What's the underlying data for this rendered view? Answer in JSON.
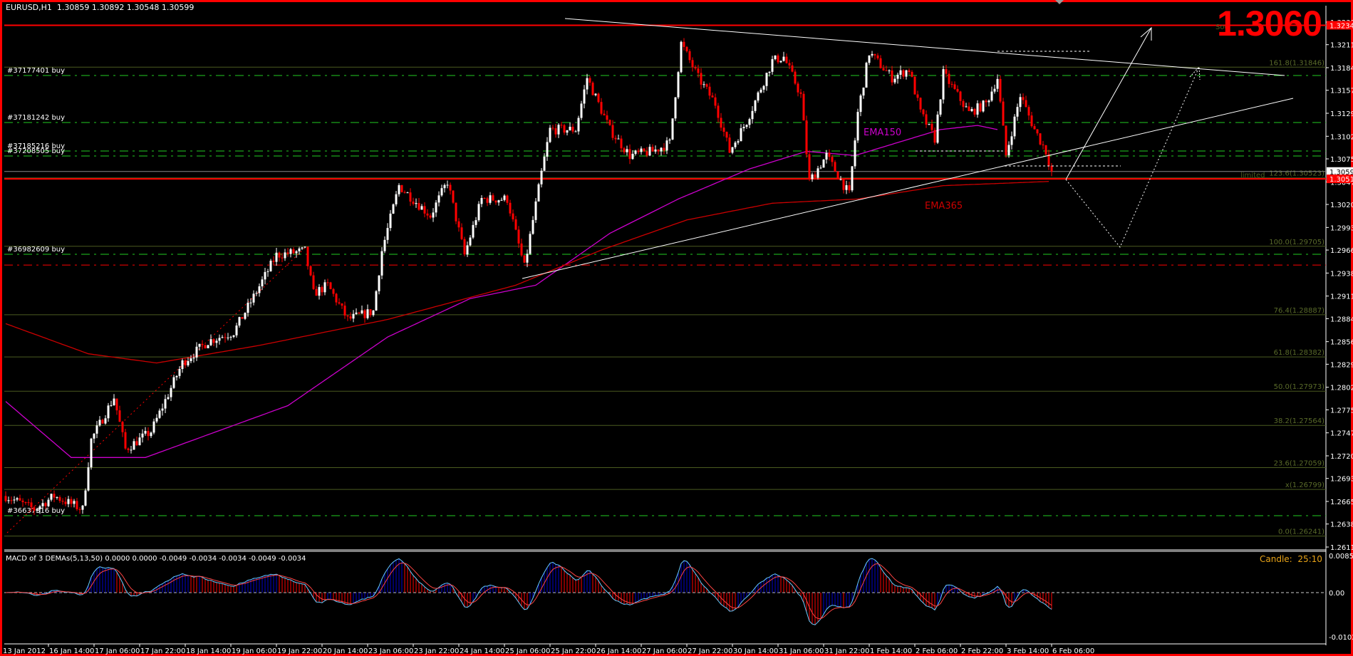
{
  "header": {
    "symbol": "EURUSD,H1",
    "open": "1.30859",
    "high": "1.30892",
    "low": "1.30548",
    "close": "1.30599"
  },
  "big_price": "1.3060",
  "candle_timer": {
    "label": "Candle:",
    "value": "25:10"
  },
  "macd": {
    "title": "MACD of 3 DEMAs(5,13,50) 0.0000 0.0000 -0.0049 -0.0034 -0.0034 -0.0049 -0.0034",
    "scale": [
      "0.0085",
      "0.00",
      "-0.0102"
    ]
  },
  "labels": {
    "ema150": "EMA150",
    "ema365": "EMA365",
    "limited": "limited",
    "source": "Sou"
  },
  "colors": {
    "bull": "#ffffff",
    "bear": "#ff0000",
    "ema150": "#cc00cc",
    "ema365": "#cc0000",
    "fib": "#4b5b20",
    "order": "#22cc22",
    "stop": "#ff0000",
    "macd_pos": "#0000cc",
    "macd_neg": "#ff0000",
    "macd_line": "#66ccff",
    "signal": "#ff4444",
    "timer": "#e8a317"
  },
  "orders": [
    {
      "label": "#37177401 buy",
      "price": 1.31746
    },
    {
      "label": "#37181242 buy",
      "price": 1.31185
    },
    {
      "label": "#37185216 buy",
      "price": 1.30844
    },
    {
      "label": "#37208505 buy",
      "price": 1.30784
    },
    {
      "label": "#36982609 buy",
      "price": 1.29609
    },
    {
      "label": "#36637316 buy",
      "price": 1.26485
    }
  ],
  "stop_level": 1.29481,
  "fib_levels": [
    {
      "label": "161.8(1.31846)",
      "price": 1.31846
    },
    {
      "label": "123.6(1.30523)",
      "price": 1.30523
    },
    {
      "label": "100.0(1.29705)",
      "price": 1.29705
    },
    {
      "label": "76.4(1.28887)",
      "price": 1.28887
    },
    {
      "label": "61.8(1.28382)",
      "price": 1.28382
    },
    {
      "label": "50.0(1.27973)",
      "price": 1.27973
    },
    {
      "label": "38.2(1.27564)",
      "price": 1.27564
    },
    {
      "label": "23.6(1.27059)",
      "price": 1.27059
    },
    {
      "label": "x(1.26799)",
      "price": 1.26799
    },
    {
      "label": "0.0(1.26241)",
      "price": 1.26241
    }
  ],
  "price_tags": [
    {
      "label": "1.32347",
      "price": 1.32347,
      "style": "red"
    },
    {
      "label": "1.30599",
      "price": 1.30599,
      "style": "white"
    },
    {
      "label": "1.30511",
      "price": 1.30511,
      "style": "red"
    }
  ],
  "chart_data": {
    "type": "candlestick",
    "title": "EURUSD,H1",
    "y_axis_ticks": [
      "1.32385",
      "1.32115",
      "1.31840",
      "1.31570",
      "1.31295",
      "1.31020",
      "1.30750",
      "1.30475",
      "1.30205",
      "1.29930",
      "1.29660",
      "1.29385",
      "1.29110",
      "1.28840",
      "1.28565",
      "1.28295",
      "1.28020",
      "1.27750",
      "1.27475",
      "1.27200",
      "1.26930",
      "1.26655",
      "1.26385",
      "1.26110"
    ],
    "ylim": [
      1.2611,
      1.32385
    ],
    "x_axis_ticks": [
      "13 Jan 2012",
      "16 Jan 14:00",
      "17 Jan 06:00",
      "17 Jan 22:00",
      "18 Jan 14:00",
      "19 Jan 06:00",
      "19 Jan 22:00",
      "20 Jan 14:00",
      "23 Jan 06:00",
      "23 Jan 22:00",
      "24 Jan 14:00",
      "25 Jan 06:00",
      "25 Jan 22:00",
      "26 Jan 14:00",
      "27 Jan 06:00",
      "27 Jan 22:00",
      "30 Jan 14:00",
      "31 Jan 06:00",
      "31 Jan 22:00",
      "1 Feb 14:00",
      "2 Feb 06:00",
      "2 Feb 22:00",
      "3 Feb 14:00",
      "6 Feb 06:00"
    ],
    "bars": 368,
    "close_anchors": [
      [
        0,
        1.2672
      ],
      [
        10,
        1.2656
      ],
      [
        17,
        1.2672
      ],
      [
        27,
        1.2656
      ],
      [
        30,
        1.2739
      ],
      [
        38,
        1.279
      ],
      [
        42,
        1.2728
      ],
      [
        51,
        1.2749
      ],
      [
        62,
        1.2831
      ],
      [
        71,
        1.2857
      ],
      [
        80,
        1.2868
      ],
      [
        86,
        1.2904
      ],
      [
        95,
        1.296
      ],
      [
        105,
        1.2965
      ],
      [
        108,
        1.2914
      ],
      [
        113,
        1.2924
      ],
      [
        120,
        1.2883
      ],
      [
        129,
        1.2893
      ],
      [
        132,
        1.2965
      ],
      [
        138,
        1.3043
      ],
      [
        149,
        1.3007
      ],
      [
        155,
        1.3048
      ],
      [
        161,
        1.296
      ],
      [
        167,
        1.3027
      ],
      [
        176,
        1.3027
      ],
      [
        182,
        1.2945
      ],
      [
        188,
        1.3058
      ],
      [
        191,
        1.311
      ],
      [
        200,
        1.311
      ],
      [
        204,
        1.3172
      ],
      [
        212,
        1.311
      ],
      [
        219,
        1.3079
      ],
      [
        227,
        1.3084
      ],
      [
        233,
        1.3094
      ],
      [
        237,
        1.3213
      ],
      [
        243,
        1.3172
      ],
      [
        249,
        1.3141
      ],
      [
        254,
        1.3084
      ],
      [
        260,
        1.312
      ],
      [
        269,
        1.3192
      ],
      [
        273,
        1.3197
      ],
      [
        279,
        1.3151
      ],
      [
        282,
        1.3048
      ],
      [
        288,
        1.3079
      ],
      [
        296,
        1.3032
      ],
      [
        299,
        1.313
      ],
      [
        303,
        1.3202
      ],
      [
        311,
        1.3172
      ],
      [
        317,
        1.3182
      ],
      [
        321,
        1.313
      ],
      [
        326,
        1.3099
      ],
      [
        329,
        1.3177
      ],
      [
        338,
        1.313
      ],
      [
        344,
        1.3141
      ],
      [
        348,
        1.3172
      ],
      [
        351,
        1.3079
      ],
      [
        356,
        1.3151
      ],
      [
        361,
        1.311
      ],
      [
        365,
        1.3084
      ],
      [
        367,
        1.30599
      ]
    ],
    "series": [
      {
        "name": "EMA150",
        "anchors": [
          [
            0,
            1.2785
          ],
          [
            23,
            1.2718
          ],
          [
            49,
            1.2718
          ],
          [
            74,
            1.2749
          ],
          [
            99,
            1.278
          ],
          [
            134,
            1.2862
          ],
          [
            163,
            1.2908
          ],
          [
            186,
            1.2924
          ],
          [
            212,
            1.2986
          ],
          [
            236,
            1.3027
          ],
          [
            261,
            1.3063
          ],
          [
            281,
            1.3084
          ],
          [
            298,
            1.3079
          ],
          [
            328,
            1.311
          ],
          [
            341,
            1.3115
          ],
          [
            348,
            1.311
          ]
        ]
      },
      {
        "name": "EMA365",
        "anchors": [
          [
            0,
            1.2878
          ],
          [
            29,
            1.2842
          ],
          [
            53,
            1.2831
          ],
          [
            89,
            1.2852
          ],
          [
            134,
            1.2883
          ],
          [
            179,
            1.2924
          ],
          [
            209,
            1.2966
          ],
          [
            239,
            1.3002
          ],
          [
            269,
            1.3022
          ],
          [
            299,
            1.3027
          ],
          [
            329,
            1.3043
          ],
          [
            366,
            1.3048
          ]
        ]
      }
    ],
    "macd_ylim": [
      -0.0102,
      0.0085
    ]
  }
}
